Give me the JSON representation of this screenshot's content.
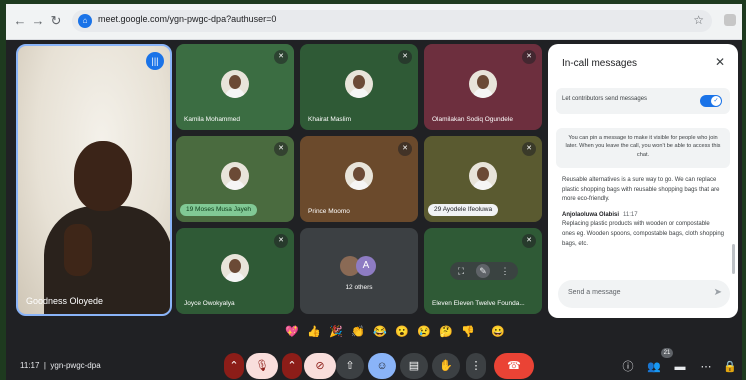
{
  "browser": {
    "url": "meet.google.com/ygn-pwgc-dpa?authuser=0",
    "icons": [
      "back-icon",
      "forward-icon",
      "reload-icon",
      "star-icon"
    ]
  },
  "self": {
    "name": "Goodness Oloyede"
  },
  "tiles": [
    {
      "name": "Kamila Mohammed"
    },
    {
      "name": "Khairat Maslim"
    },
    {
      "name": "Olamilakan Sodiq Ogundele"
    },
    {
      "name": "Moses Musa Jayeh",
      "badge": "19"
    },
    {
      "name": "Prince Moomo"
    },
    {
      "name": "Ayodele Ifeoluwa",
      "badge": "29"
    },
    {
      "name": "Joyce Owokyalya"
    },
    {
      "name": "12 others",
      "avatar_letter": "A"
    },
    {
      "name": "Eleven Eleven Twelve Founda..."
    }
  ],
  "chat": {
    "title": "In-call messages",
    "toggle_label": "Let contributors send messages",
    "info": "You can pin a message to make it visible for people who join later. When you leave the call, you won't be able to access this chat.",
    "message_1": "Reusable alternatives is a sure way to go. We can replace plastic shopping bags with reusable shopping bags that are more eco-friendly.",
    "sender": "Anjolaoluwa Olabisi",
    "sender_time": "11:17",
    "message_2": "Replacing plastic products with wooden or compostable ones eg. Wooden spoons, compostable bags, cloth shopping bags, etc.",
    "input_placeholder": "Send a message"
  },
  "reactions": [
    "💖",
    "👍",
    "🎉",
    "👏",
    "😂",
    "😮",
    "😢",
    "🤔",
    "👎",
    "😀"
  ],
  "bottom": {
    "time": "11:17",
    "meeting_code": "ygn-pwgc-dpa",
    "participant_count": "21"
  },
  "colors": {
    "accent": "#1a73e8",
    "end_call": "#ea4335",
    "background": "#202124"
  }
}
